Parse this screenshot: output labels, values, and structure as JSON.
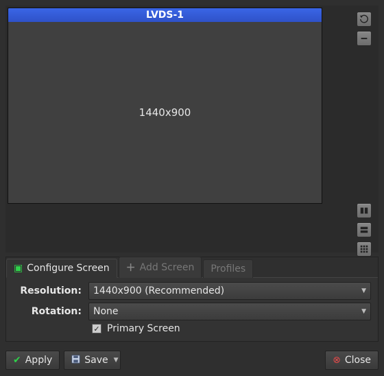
{
  "monitor": {
    "name": "LVDS-1",
    "resolution_text": "1440x900"
  },
  "tabs": {
    "configure": "Configure Screen",
    "add": "Add Screen",
    "profiles": "Profiles"
  },
  "form": {
    "resolution_label": "Resolution:",
    "resolution_value": "1440x900 (Recommended)",
    "rotation_label": "Rotation:",
    "rotation_value": "None",
    "primary_label": "Primary Screen"
  },
  "buttons": {
    "apply": "Apply",
    "save": "Save",
    "close": "Close"
  }
}
